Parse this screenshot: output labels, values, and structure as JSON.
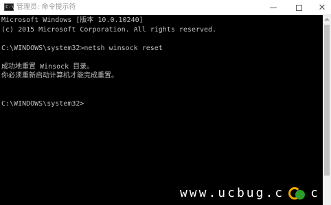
{
  "window": {
    "title": "管理员: 命令提示符",
    "icon_name": "cmd-icon",
    "icon_text": "C:\\",
    "controls": {
      "minimize": "minimize-icon",
      "maximize": "maximize-icon",
      "close": "close-icon"
    }
  },
  "console": {
    "lines": [
      "Microsoft Windows [版本 10.0.10240]",
      "(c) 2015 Microsoft Corporation. All rights reserved.",
      "",
      "C:\\WINDOWS\\system32>netsh winsock reset",
      "",
      "成功地重置 Winsock 目录。",
      "你必须重新启动计算机才能完成重置。",
      "",
      "",
      "C:\\WINDOWS\\system32>"
    ],
    "text_color": "#c0c0c0",
    "background": "#000000"
  },
  "watermark": {
    "left_text": "www.ucbug.c",
    "logo_name": "ucbug-logo",
    "right_text": "c"
  }
}
